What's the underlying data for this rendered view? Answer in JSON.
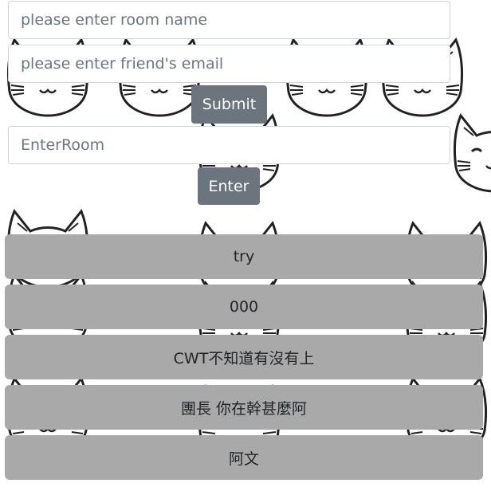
{
  "create_room": {
    "room_name_placeholder": "please enter room name",
    "friend_email_placeholder": "please enter friend's email",
    "submit_label": "Submit"
  },
  "enter_room": {
    "placeholder": "EnterRoom",
    "enter_label": "Enter"
  },
  "rooms": [
    {
      "label": "try"
    },
    {
      "label": "000"
    },
    {
      "label": "CWT不知道有沒有上"
    },
    {
      "label": "團長 你在幹甚麼阿"
    },
    {
      "label": "阿文"
    }
  ],
  "colors": {
    "button_bg": "#6c757d",
    "room_bg": "#a9a9a9",
    "background": "#ffffff"
  },
  "background_pattern": "cat-face-icon"
}
